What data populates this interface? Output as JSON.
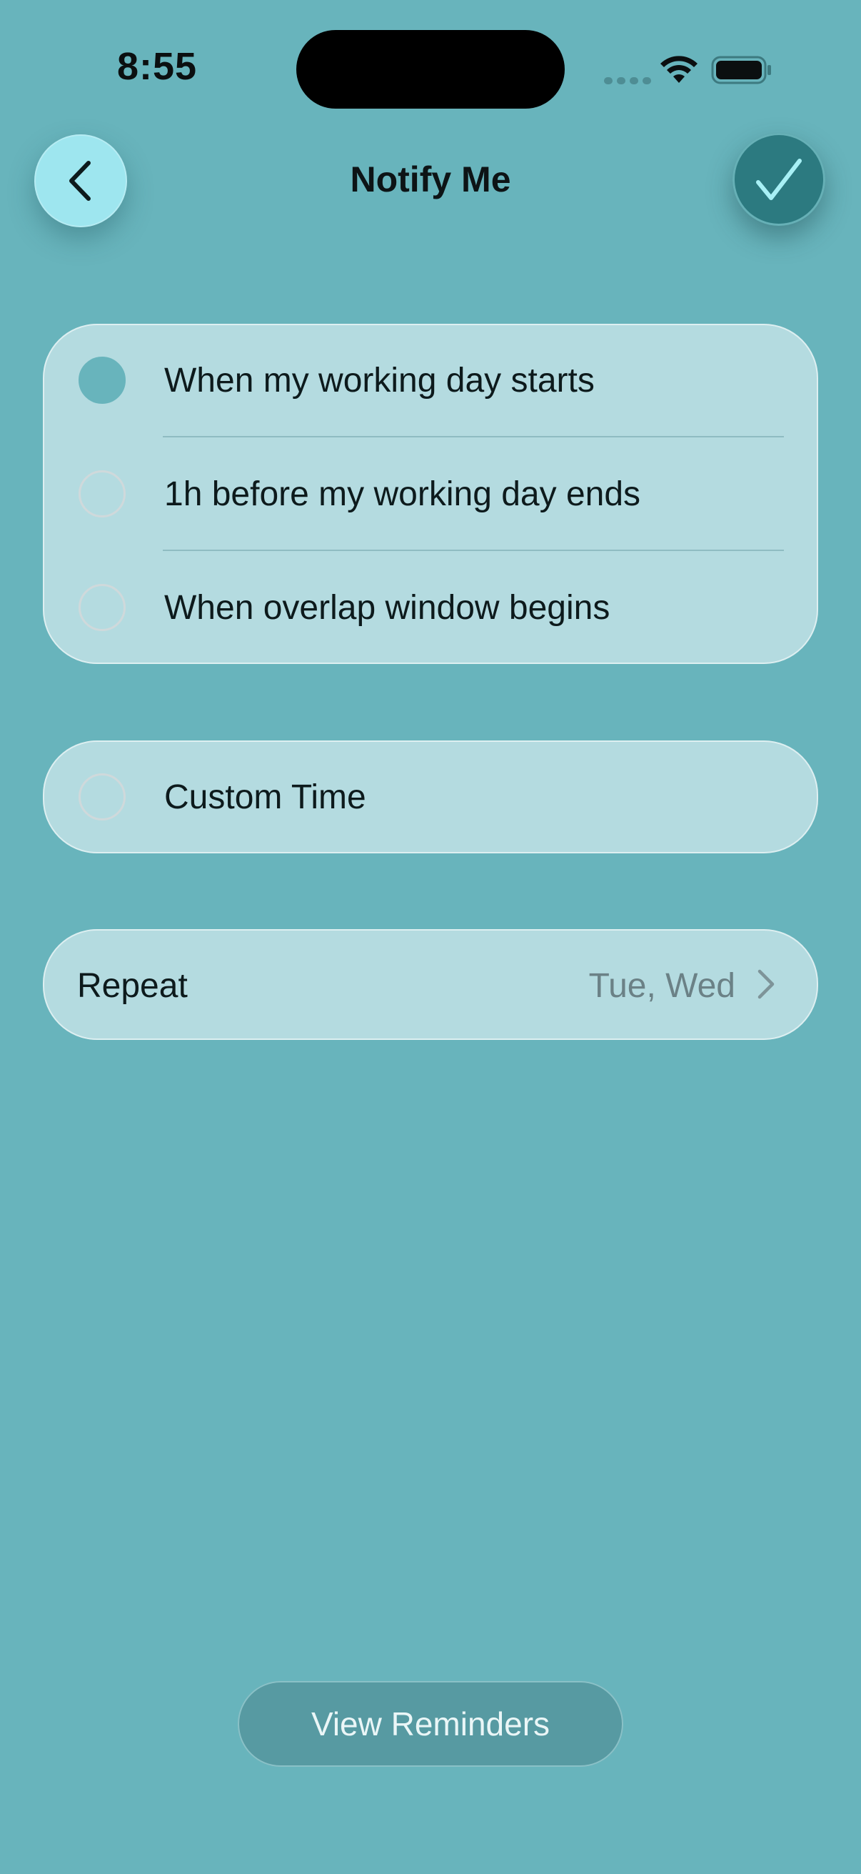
{
  "status_bar": {
    "time": "8:55"
  },
  "header": {
    "title": "Notify Me"
  },
  "icons": {
    "back": "chevron-left-icon",
    "confirm": "checkmark-icon",
    "wifi": "wifi-icon",
    "battery": "battery-icon",
    "chevron": "chevron-right-icon"
  },
  "notify_options": [
    {
      "label": "When my working day starts",
      "selected": true
    },
    {
      "label": "1h before my working day ends",
      "selected": false
    },
    {
      "label": "When overlap window begins",
      "selected": false
    }
  ],
  "custom_option": {
    "label": "Custom Time",
    "selected": false
  },
  "repeat": {
    "label": "Repeat",
    "value": "Tue, Wed"
  },
  "footer": {
    "button_label": "View Reminders"
  },
  "colors": {
    "background": "#68b4bc",
    "card": "#b4dbe0",
    "accent": "#2c7a80",
    "back_button": "#9ee6ef"
  }
}
